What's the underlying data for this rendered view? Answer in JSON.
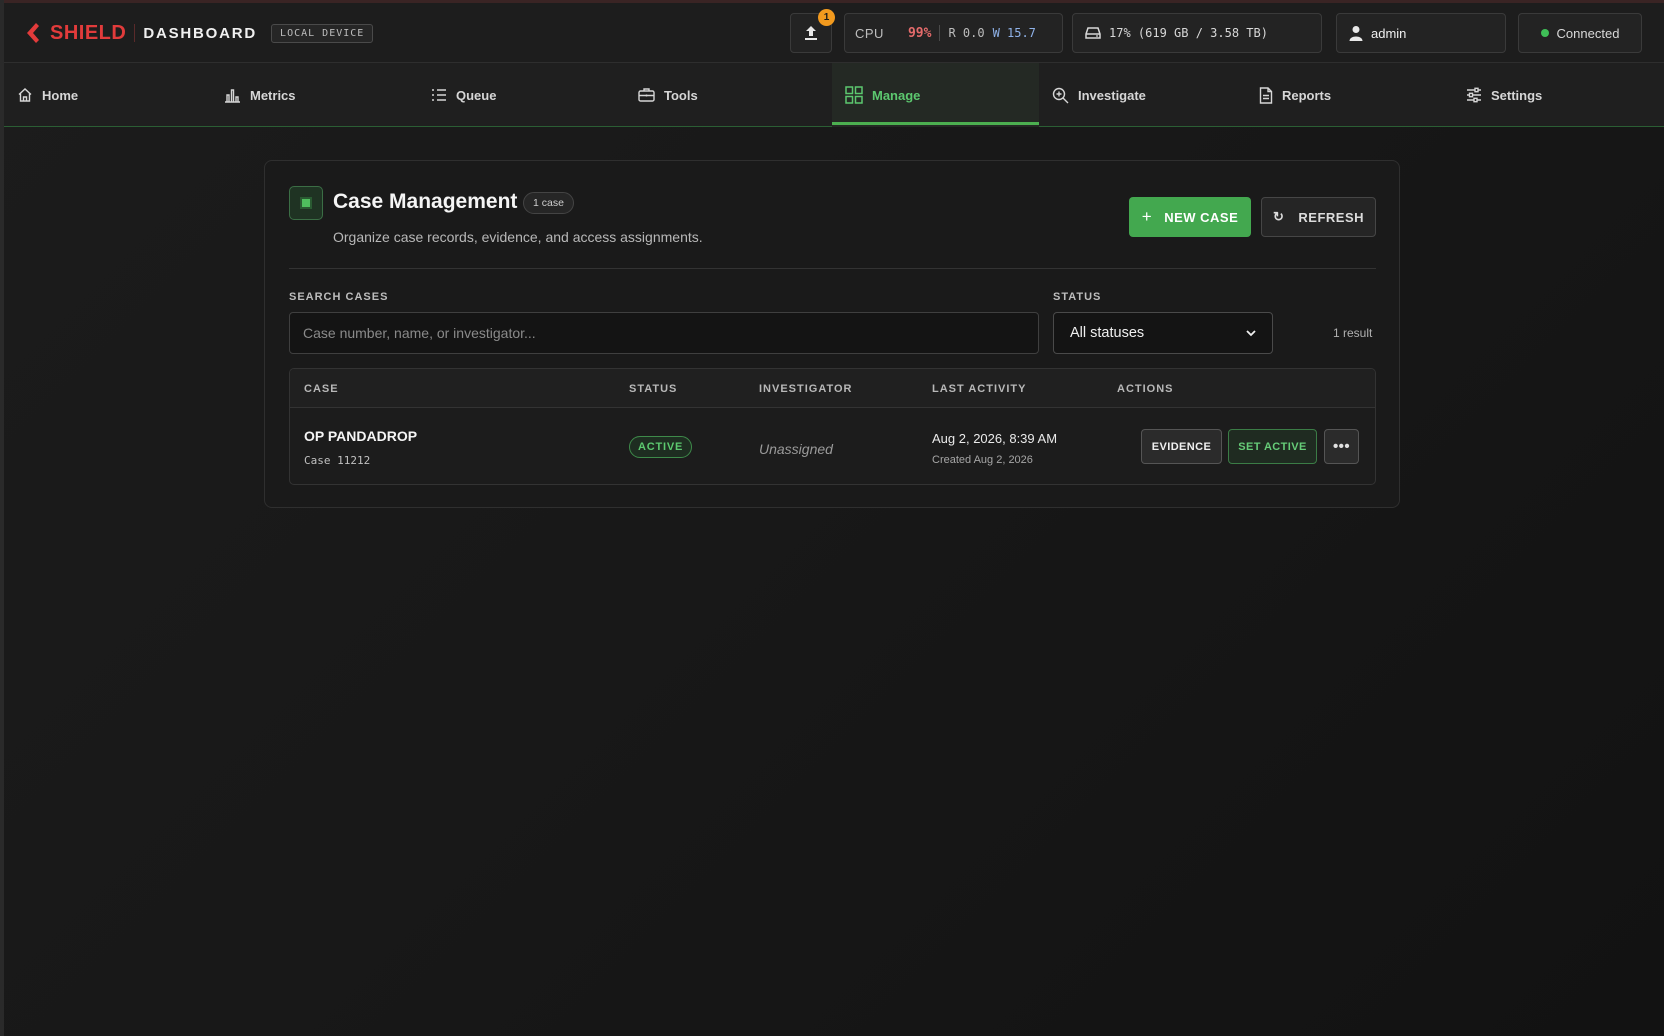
{
  "brand": {
    "name": "SHIELD",
    "subtitle": "DASHBOARD",
    "badge": "LOCAL DEVICE"
  },
  "header": {
    "upload_badge": "1",
    "cpu": {
      "label": "CPU",
      "percent": "99%",
      "read": "R 0.0",
      "write": "W 15.7"
    },
    "disk": "17% (619 GB / 3.58 TB)",
    "user": "admin",
    "connection": "Connected"
  },
  "nav": {
    "tabs": [
      {
        "label": "Home",
        "icon": "home-icon"
      },
      {
        "label": "Metrics",
        "icon": "bar-chart-icon"
      },
      {
        "label": "Queue",
        "icon": "list-icon"
      },
      {
        "label": "Tools",
        "icon": "briefcase-icon"
      },
      {
        "label": "Manage",
        "icon": "grid-icon",
        "active": true
      },
      {
        "label": "Investigate",
        "icon": "zoom-in-icon"
      },
      {
        "label": "Reports",
        "icon": "document-icon"
      },
      {
        "label": "Settings",
        "icon": "sliders-icon"
      }
    ]
  },
  "case_mgmt": {
    "title": "Case Management",
    "count": "1 case",
    "subtitle": "Organize case records, evidence, and access assignments.",
    "new_case_label": "NEW CASE",
    "refresh_label": "REFRESH",
    "search_label": "SEARCH CASES",
    "search_placeholder": "Case number, name, or investigator...",
    "status_label": "STATUS",
    "status_value": "All statuses",
    "result_count": "1 result",
    "columns": [
      "CASE",
      "STATUS",
      "INVESTIGATOR",
      "LAST ACTIVITY",
      "ACTIONS"
    ],
    "rows": [
      {
        "name": "OP PANDADROP",
        "number": "Case 11212",
        "status": "ACTIVE",
        "investigator": "Unassigned",
        "last_activity": "Aug 2, 2026, 8:39 AM",
        "created": "Created Aug 2, 2026",
        "actions": {
          "evidence": "EVIDENCE",
          "set_active": "SET ACTIVE",
          "more": "•••"
        }
      }
    ]
  },
  "colors": {
    "brand_red": "#e23b3b",
    "accent_green": "#4caf50",
    "warn_orange": "#f29a1e"
  }
}
